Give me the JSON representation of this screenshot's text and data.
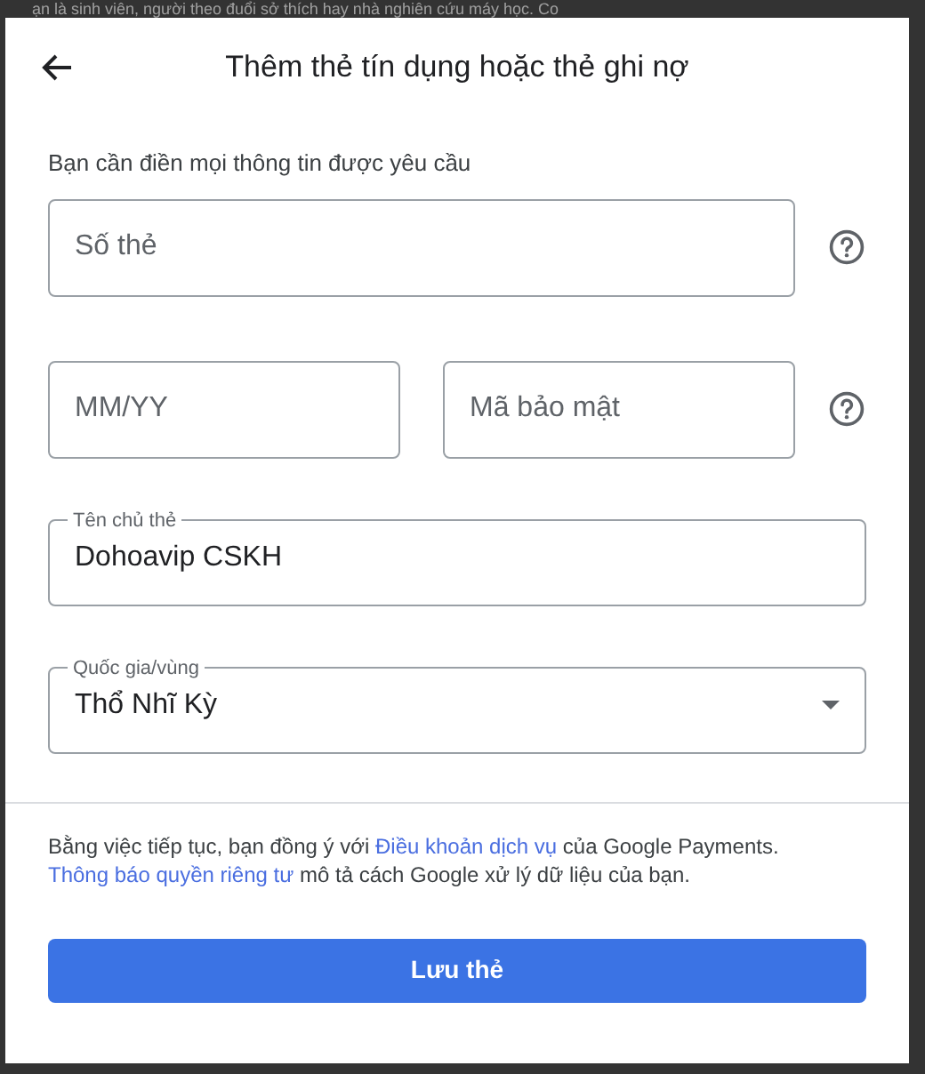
{
  "background": {
    "text": "ạn là sinh viên, người theo đuổi sở thích hay nhà nghiên cứu máy học. Co"
  },
  "dialog": {
    "title": "Thêm thẻ tín dụng hoặc thẻ ghi nợ",
    "notice": "Bạn cần điền mọi thông tin được yêu cầu",
    "rows": [
      {
        "help": true,
        "fields": [
          {
            "kind": "text",
            "placeholder": "Số thẻ"
          }
        ]
      },
      {
        "help": true,
        "fields": [
          {
            "kind": "text",
            "placeholder": "MM/YY"
          },
          {
            "kind": "text",
            "placeholder": "Mã bảo mật"
          }
        ]
      },
      {
        "help": false,
        "fields": [
          {
            "kind": "text",
            "label": "Tên chủ thẻ",
            "value": "Dohoavip CSKH"
          }
        ]
      },
      {
        "help": false,
        "fields": [
          {
            "kind": "select",
            "label": "Quốc gia/vùng",
            "value": "Thổ Nhĩ Kỳ"
          }
        ]
      }
    ],
    "legal": [
      {
        "kind": "text",
        "text": "Bằng việc tiếp tục, bạn đồng ý với "
      },
      {
        "kind": "link",
        "text": "Điều khoản dịch vụ"
      },
      {
        "kind": "text",
        "text": " của Google Payments. "
      },
      {
        "kind": "link",
        "text": "Thông báo quyền riêng tư"
      },
      {
        "kind": "text",
        "text": " mô tả cách Google xử lý dữ liệu của bạn."
      }
    ],
    "button": "Lưu thẻ"
  }
}
